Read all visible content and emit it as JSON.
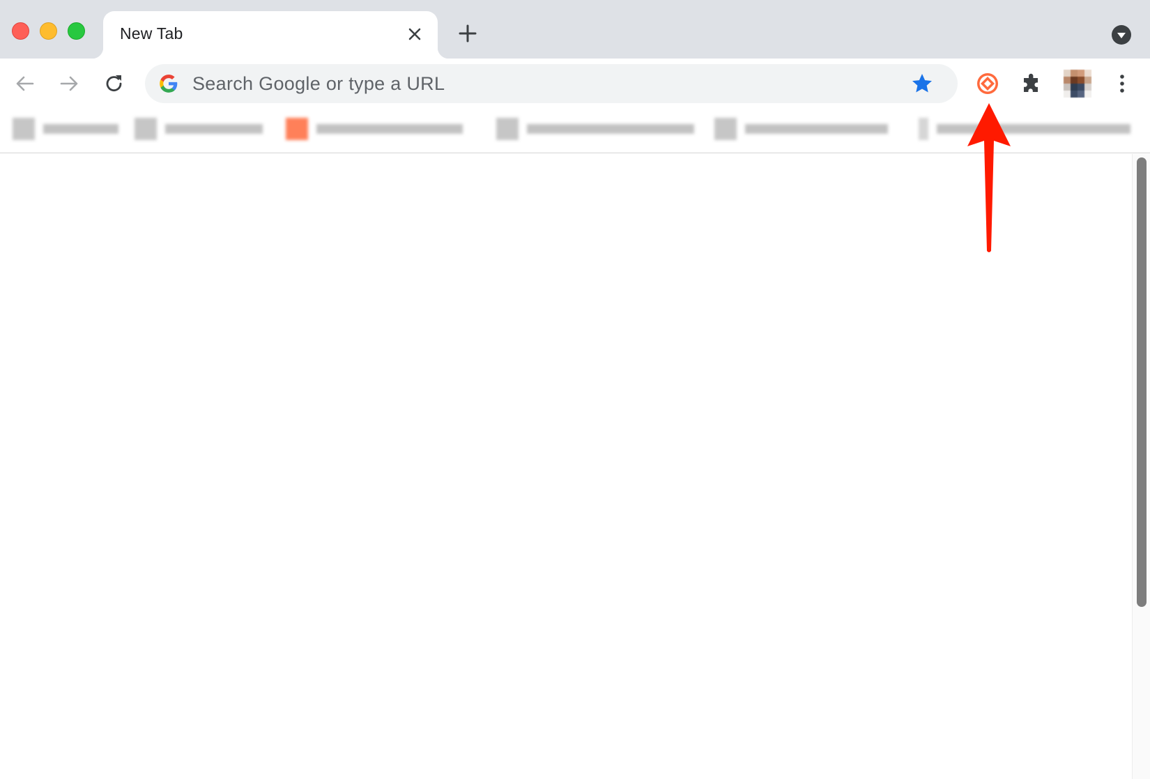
{
  "window": {
    "traffic_lights": [
      "close",
      "minimize",
      "zoom"
    ],
    "colors": {
      "close": "#fe5f57",
      "minimize": "#febc2e",
      "zoom": "#28c840"
    }
  },
  "tabs": [
    {
      "title": "New Tab",
      "active": true
    }
  ],
  "toolbar": {
    "omnibox_placeholder": "Search Google or type a URL",
    "icons": [
      "back-arrow-icon",
      "forward-arrow-icon",
      "reload-icon",
      "google-g-icon",
      "bookmark-star-icon",
      "extension-icon",
      "puzzle-extensions-icon",
      "profile-avatar",
      "kebab-menu-icon"
    ],
    "star_color": "#1a73e8",
    "extension_color": "#ff6a3d"
  },
  "bookmarks_bar": {
    "count": 6,
    "items_blurred": true
  },
  "annotation": {
    "type": "arrow",
    "color": "#ff1a00",
    "points_to": "extension-icon"
  }
}
